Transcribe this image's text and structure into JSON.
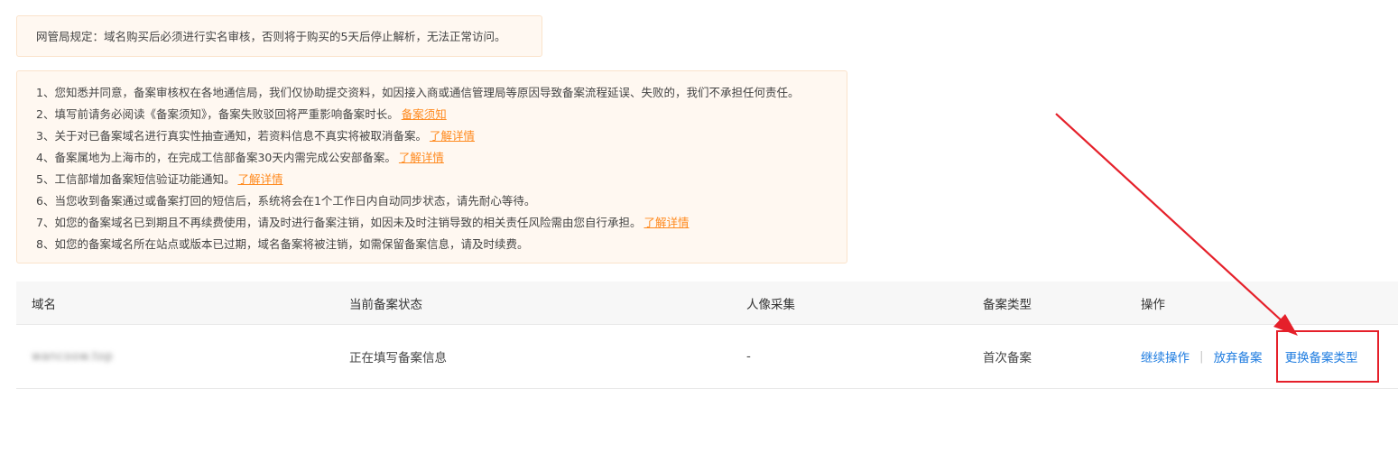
{
  "notice": {
    "text": "网管局规定：域名购买后必须进行实名审核，否则将于购买的5天后停止解析，无法正常访问。"
  },
  "terms": [
    {
      "text": "1、您知悉并同意，备案审核权在各地通信局，我们仅协助提交资料，如因接入商或通信管理局等原因导致备案流程延误、失败的，我们不承担任何责任。",
      "link": ""
    },
    {
      "text": "2、填写前请务必阅读《备案须知》，备案失败驳回将严重影响备案时长。",
      "link": "备案须知"
    },
    {
      "text": "3、关于对已备案域名进行真实性抽查通知，若资料信息不真实将被取消备案。",
      "link": "了解详情"
    },
    {
      "text": "4、备案属地为上海市的，在完成工信部备案30天内需完成公安部备案。",
      "link": "了解详情"
    },
    {
      "text": "5、工信部增加备案短信验证功能通知。",
      "link": "了解详情"
    },
    {
      "text": "6、当您收到备案通过或备案打回的短信后，系统将会在1个工作日内自动同步状态，请先耐心等待。",
      "link": ""
    },
    {
      "text": "7、如您的备案域名已到期且不再续费使用，请及时进行备案注销，如因未及时注销导致的相关责任风险需由您自行承担。",
      "link": "了解详情"
    },
    {
      "text": "8、如您的备案域名所在站点或版本已过期，域名备案将被注销，如需保留备案信息，请及时续费。",
      "link": ""
    }
  ],
  "table": {
    "headers": [
      "域名",
      "当前备案状态",
      "人像采集",
      "备案类型",
      "操作"
    ],
    "row": {
      "domain": "wancoow.top",
      "status": "正在填写备案信息",
      "portrait": "-",
      "type": "首次备案",
      "actions": {
        "continue": "继续操作",
        "separator": "|",
        "abandon": "放弃备案",
        "change_type": "更换备案类型"
      }
    }
  },
  "colors": {
    "link_orange": "#ff8a1f",
    "link_blue": "#1e7ce0",
    "annotation_red": "#e5202a"
  }
}
